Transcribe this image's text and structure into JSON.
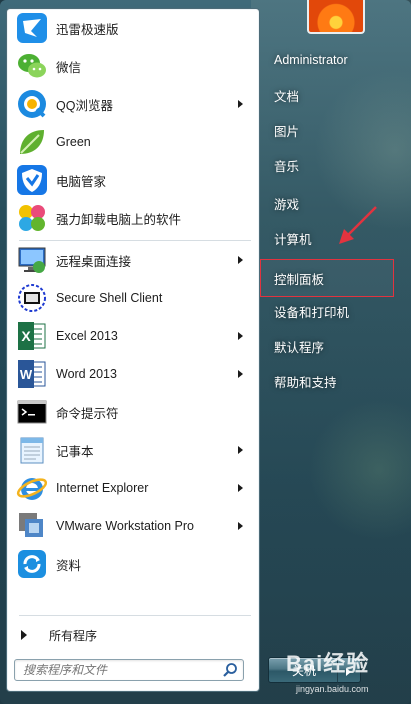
{
  "programs": [
    {
      "label": "迅雷极速版",
      "icon": "xunlei-icon",
      "arrow": false
    },
    {
      "label": "微信",
      "icon": "wechat-icon",
      "arrow": false
    },
    {
      "label": "QQ浏览器",
      "icon": "qq-browser-icon",
      "arrow": true
    },
    {
      "label": "Green",
      "icon": "leaf-icon",
      "arrow": false
    },
    {
      "label": "电脑管家",
      "icon": "shield-icon",
      "arrow": false
    },
    {
      "label": "强力卸载电脑上的软件",
      "icon": "uninstall-icon",
      "arrow": false
    },
    {
      "label": "远程桌面连接",
      "icon": "remote-desktop-icon",
      "arrow": true
    },
    {
      "label": "Secure Shell Client",
      "icon": "ssh-icon",
      "arrow": false
    },
    {
      "label": "Excel 2013",
      "icon": "excel-icon",
      "arrow": true
    },
    {
      "label": "Word 2013",
      "icon": "word-icon",
      "arrow": true
    },
    {
      "label": "命令提示符",
      "icon": "cmd-icon",
      "arrow": false
    },
    {
      "label": "记事本",
      "icon": "notepad-icon",
      "arrow": true
    },
    {
      "label": "Internet Explorer",
      "icon": "ie-icon",
      "arrow": true
    },
    {
      "label": "VMware Workstation Pro",
      "icon": "vmware-icon",
      "arrow": true
    },
    {
      "label": "资料",
      "icon": "sync-folder-icon",
      "arrow": false
    }
  ],
  "all_programs_label": "所有程序",
  "search": {
    "placeholder": "搜索程序和文件"
  },
  "right_links": [
    {
      "label": "Administrator"
    },
    {
      "label": "文档"
    },
    {
      "label": "图片"
    },
    {
      "label": "音乐"
    },
    {
      "label": "游戏"
    },
    {
      "label": "计算机"
    },
    {
      "label": "控制面板"
    },
    {
      "label": "设备和打印机"
    },
    {
      "label": "默认程序"
    },
    {
      "label": "帮助和支持"
    }
  ],
  "shutdown_label": "关机",
  "watermark": {
    "text": "Bai经验",
    "url": "jingyan.baidu.com"
  },
  "colors": {
    "highlight": "#e2333f",
    "annotation_arrow": "#e2333f"
  }
}
